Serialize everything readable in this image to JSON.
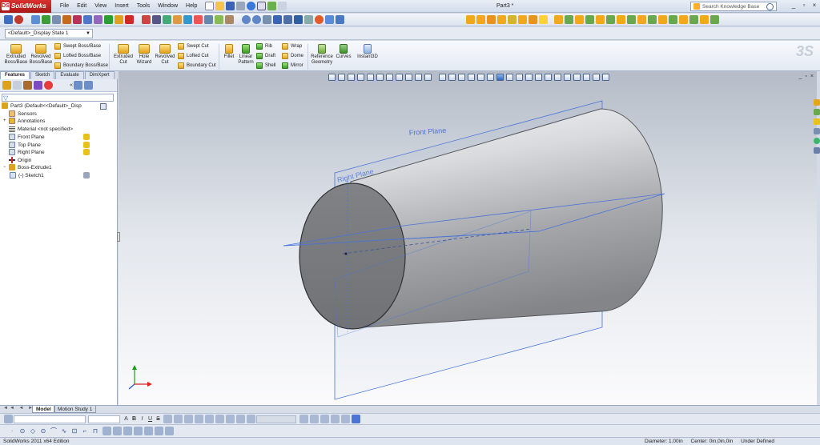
{
  "app": {
    "logo": "SolidWorks",
    "doc_title": "Part3 *"
  },
  "menu": [
    "File",
    "Edit",
    "View",
    "Insert",
    "Tools",
    "Window",
    "Help"
  ],
  "search": {
    "placeholder": "Search Knowledge Base"
  },
  "window_controls": {
    "minimize": "_",
    "restore": "▫",
    "close": "×"
  },
  "config": {
    "display_state": "<Default>_Display State 1"
  },
  "commands": {
    "extruded_boss": "Extruded\nBoss/Base",
    "revolved_boss": "Revolved\nBoss/Base",
    "swept_boss": "Swept Boss/Base",
    "lofted_boss": "Lofted Boss/Base",
    "boundary_boss": "Boundary Boss/Base",
    "extruded_cut": "Extruded\nCut",
    "hole_wizard": "Hole\nWizard",
    "revolved_cut": "Revolved\nCut",
    "swept_cut": "Swept Cut",
    "lofted_cut": "Lofted Cut",
    "boundary_cut": "Boundary Cut",
    "fillet": "Fillet",
    "linear_pattern": "Linear\nPattern",
    "rib": "Rib",
    "draft": "Draft",
    "shell": "Shell",
    "wrap": "Wrap",
    "dome": "Dome",
    "mirror": "Mirror",
    "reference_geometry": "Reference\nGeometry",
    "curves": "Curves",
    "instant3d": "Instant3D"
  },
  "tabs": {
    "features": "Features",
    "sketch": "Sketch",
    "evaluate": "Evaluate",
    "dimxpert": "DimXpert"
  },
  "tree": {
    "part": "Part3  (Default<<Default>_Disp",
    "sensors": "Sensors",
    "annotations": "Annotations",
    "material": "Material <not specified>",
    "front_plane": "Front Plane",
    "top_plane": "Top Plane",
    "right_plane": "Right Plane",
    "origin": "Origin",
    "boss_extrude": "Boss-Extrude1",
    "sketch": "(-) Sketch1"
  },
  "viewport": {
    "front_plane_label": "Front Plane",
    "right_plane_label": "Right Plane",
    "controls": [
      "_",
      "▫",
      "×"
    ]
  },
  "bottom_tabs": {
    "model": "Model",
    "motion_study": "Motion Study 1",
    "arrows": "◄◄ ◄ ► ►►"
  },
  "format_toolbar": {
    "buttons": [
      "A",
      "B",
      "I",
      "U",
      "S"
    ]
  },
  "sketch_toolbar": [
    "·",
    "⊙",
    "◇",
    "⊙",
    "⌒",
    "∿",
    "⊡",
    "⌐",
    "⊓"
  ],
  "status": {
    "left": "SolidWorks 2011 x64 Edition",
    "diameter": "Diameter: 1.00in",
    "center": "Center: 0in,0in,0in",
    "state": "Under Defined"
  },
  "colors": {
    "brand": "#c22a27",
    "selection": "#2b6fd1",
    "plane": "#4a74d8"
  }
}
